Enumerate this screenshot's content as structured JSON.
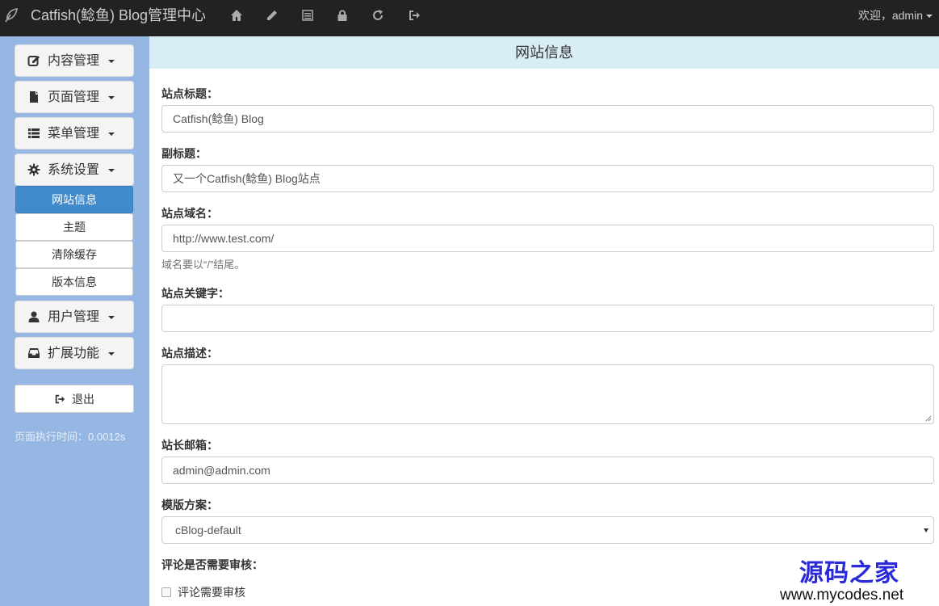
{
  "header": {
    "brand": "Catfish(鲶鱼) Blog管理中心",
    "logo_icon": "feather-icon",
    "nav_icons": [
      "home-icon",
      "pencil-icon",
      "list-icon",
      "lock-icon",
      "refresh-icon",
      "logout-icon"
    ],
    "welcome": "欢迎，admin"
  },
  "sidebar": {
    "menus": [
      {
        "label": "内容管理",
        "icon": "edit-icon"
      },
      {
        "label": "页面管理",
        "icon": "file-icon"
      },
      {
        "label": "菜单管理",
        "icon": "list-icon"
      },
      {
        "label": "系统设置",
        "icon": "gear-icon"
      },
      {
        "label": "用户管理",
        "icon": "user-icon"
      },
      {
        "label": "扩展功能",
        "icon": "inbox-icon"
      }
    ],
    "submenu": [
      {
        "label": "网站信息",
        "active": true
      },
      {
        "label": "主题",
        "active": false
      },
      {
        "label": "清除缓存",
        "active": false
      },
      {
        "label": "版本信息",
        "active": false
      }
    ],
    "logout": "退出",
    "exec_time": "页面执行时间：0.0012s"
  },
  "main": {
    "panel_title": "网站信息",
    "fields": {
      "site_title": {
        "label": "站点标题：",
        "value": "Catfish(鲶鱼) Blog"
      },
      "subtitle": {
        "label": "副标题：",
        "value": "又一个Catfish(鲶鱼) Blog站点"
      },
      "domain": {
        "label": "站点域名：",
        "value": "http://www.test.com/",
        "help": "域名要以“/”结尾。"
      },
      "keywords": {
        "label": "站点关键字：",
        "value": ""
      },
      "description": {
        "label": "站点描述：",
        "value": ""
      },
      "email": {
        "label": "站长邮箱：",
        "value": "admin@admin.com"
      },
      "template": {
        "label": "模版方案：",
        "value": "cBlog-default"
      },
      "comment_review": {
        "label": "评论是否需要审核：",
        "checkbox_label": "评论需要审核",
        "checked": false
      }
    }
  },
  "watermark": {
    "title": "源码之家",
    "url": "www.mycodes.net"
  },
  "colors": {
    "navbar": "#222222",
    "sidebar": "#96b7e3",
    "active": "#428bca",
    "panel_head": "#d9edf7",
    "watermark": "#2a2ad8"
  }
}
